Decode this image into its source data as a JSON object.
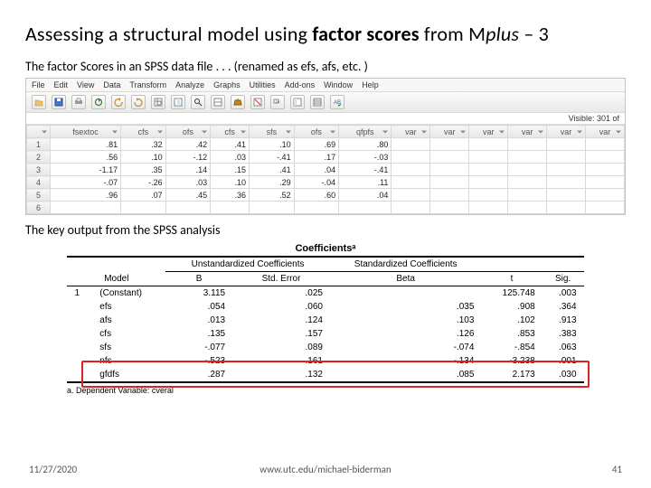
{
  "title": {
    "pre": "Assessing a structural model using ",
    "bold": "factor scores",
    "post_pre": " from M",
    "ital": "plus",
    "post": " – 3"
  },
  "subhead1": "The factor Scores in an SPSS data file . . . (renamed as efs, afs, etc. )",
  "spss": {
    "menu": [
      "File",
      "Edit",
      "View",
      "Data",
      "Transform",
      "Analyze",
      "Graphs",
      "Utilities",
      "Add-ons",
      "Window",
      "Help"
    ],
    "visible": "Visible: 301 of",
    "headers": [
      "fsextoc",
      "cfs",
      "ofs",
      "cfs",
      "sfs",
      "ofs",
      "qfpfs",
      "var",
      "var",
      "var",
      "var",
      "var",
      "var"
    ],
    "rows": [
      {
        "n": "1",
        "v": [
          ".81",
          ".32",
          ".42",
          ".41",
          ".10",
          ".69",
          ".80"
        ]
      },
      {
        "n": "2",
        "v": [
          ".56",
          ".10",
          "-.12",
          ".03",
          "-.41",
          ".17",
          "-.03"
        ]
      },
      {
        "n": "3",
        "v": [
          "-1.17",
          ".35",
          ".14",
          ".15",
          ".41",
          ".04",
          "-.41"
        ]
      },
      {
        "n": "4",
        "v": [
          "-.07",
          "-.26",
          ".03",
          ".10",
          ".29",
          "-.04",
          ".11"
        ]
      },
      {
        "n": "5",
        "v": [
          ".96",
          ".07",
          ".45",
          ".36",
          ".52",
          ".60",
          ".04"
        ]
      },
      {
        "n": "6",
        "v": [
          "",
          "",
          "",
          "",
          "",
          "",
          ""
        ]
      }
    ]
  },
  "subhead2": "The key output from the SPSS analysis",
  "coef": {
    "title": "Coefficientsᵃ",
    "group1": "Unstandardized Coefficients",
    "group2": "Standardized Coefficients",
    "cols": {
      "model": "Model",
      "b": "B",
      "se": "Std. Error",
      "beta": "Beta",
      "t": "t",
      "sig": "Sig."
    },
    "rows": [
      {
        "m": "1",
        "lbl": "(Constant)",
        "b": "3.115",
        "se": ".025",
        "beta": "",
        "t": "125.748",
        "sig": ".003"
      },
      {
        "m": "",
        "lbl": "efs",
        "b": ".054",
        "se": ".060",
        "beta": ".035",
        "t": ".908",
        "sig": ".364"
      },
      {
        "m": "",
        "lbl": "afs",
        "b": ".013",
        "se": ".124",
        "beta": ".103",
        "t": ".102",
        "sig": ".913"
      },
      {
        "m": "",
        "lbl": "cfs",
        "b": ".135",
        "se": ".157",
        "beta": ".126",
        "t": ".853",
        "sig": ".383"
      },
      {
        "m": "",
        "lbl": "sfs",
        "b": "-.077",
        "se": ".089",
        "beta": "-.074",
        "t": "-.854",
        "sig": ".063"
      },
      {
        "m": "",
        "lbl": "nfs",
        "b": "-.523",
        "se": ".161",
        "beta": "-.134",
        "t": "-3.238",
        "sig": ".001"
      },
      {
        "m": "",
        "lbl": "gfdfs",
        "b": ".287",
        "se": ".132",
        "beta": ".085",
        "t": "2.173",
        "sig": ".030"
      }
    ],
    "note": "a. Dependent Variable: cveral"
  },
  "footer": {
    "date": "11/27/2020",
    "url": "www.utc.edu/michael-biderman",
    "page": "41"
  }
}
